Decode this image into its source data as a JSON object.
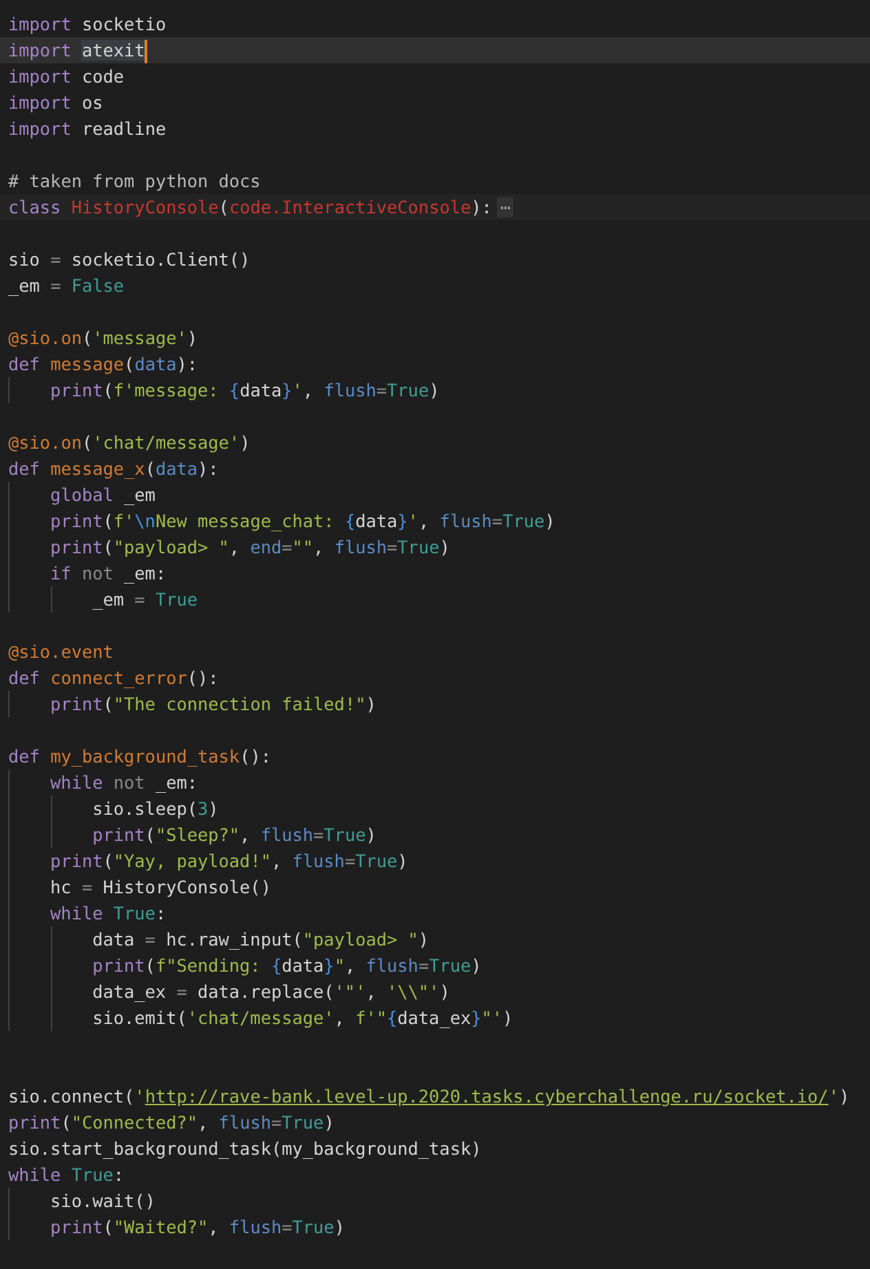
{
  "editor": {
    "lines": [
      {
        "kind": "code",
        "current": false,
        "tokens": [
          {
            "kind": "kw",
            "text": "import"
          },
          {
            "kind": "plain",
            "text": " socketio"
          }
        ]
      },
      {
        "kind": "code",
        "current": true,
        "tokens": [
          {
            "kind": "kw",
            "text": "import "
          },
          {
            "kind": "sel",
            "text": "atexit"
          }
        ]
      },
      {
        "kind": "code",
        "current": false,
        "tokens": [
          {
            "kind": "kw",
            "text": "import"
          },
          {
            "kind": "plain",
            "text": " code"
          }
        ]
      },
      {
        "kind": "code",
        "current": false,
        "tokens": [
          {
            "kind": "kw",
            "text": "import"
          },
          {
            "kind": "plain",
            "text": " os"
          }
        ]
      },
      {
        "kind": "code",
        "current": false,
        "tokens": [
          {
            "kind": "kw",
            "text": "import"
          },
          {
            "kind": "plain",
            "text": " readline"
          }
        ]
      },
      {
        "kind": "blank"
      },
      {
        "kind": "code",
        "current": false,
        "tokens": [
          {
            "kind": "comment",
            "text": "# taken from python docs"
          }
        ]
      },
      {
        "kind": "code",
        "current": false,
        "tokens": [
          {
            "kind": "kw",
            "text": "class "
          },
          {
            "kind": "cls",
            "text": "HistoryConsole"
          },
          {
            "kind": "plain",
            "text": "("
          },
          {
            "kind": "cls",
            "text": "code.InteractiveConsole"
          },
          {
            "kind": "plain",
            "text": "):"
          },
          {
            "kind": "fold",
            "text": "⋯"
          }
        ]
      },
      {
        "kind": "blank"
      },
      {
        "kind": "code",
        "current": false,
        "tokens": [
          {
            "kind": "plain",
            "text": "sio "
          },
          {
            "kind": "op",
            "text": "="
          },
          {
            "kind": "plain",
            "text": " socketio.Client()"
          }
        ]
      },
      {
        "kind": "code",
        "current": false,
        "tokens": [
          {
            "kind": "plain",
            "text": "_em "
          },
          {
            "kind": "op",
            "text": "="
          },
          {
            "kind": "const",
            "text": " False"
          }
        ]
      },
      {
        "kind": "blank"
      },
      {
        "kind": "code",
        "current": false,
        "tokens": [
          {
            "kind": "func",
            "text": "@sio.on"
          },
          {
            "kind": "plain",
            "text": "("
          },
          {
            "kind": "str",
            "text": "'message'"
          },
          {
            "kind": "plain",
            "text": ")"
          }
        ]
      },
      {
        "kind": "code",
        "current": false,
        "tokens": [
          {
            "kind": "kw",
            "text": "def "
          },
          {
            "kind": "func",
            "text": "message"
          },
          {
            "kind": "plain",
            "text": "("
          },
          {
            "kind": "param",
            "text": "data"
          },
          {
            "kind": "plain",
            "text": "):"
          }
        ],
        "children": [
          {
            "kind": "code",
            "current": false,
            "tokens": [
              {
                "kind": "kw",
                "text": "print"
              },
              {
                "kind": "plain",
                "text": "("
              },
              {
                "kind": "str",
                "text": "f'message: "
              },
              {
                "kind": "interp",
                "text": "{"
              },
              {
                "kind": "plain",
                "text": "data"
              },
              {
                "kind": "interp",
                "text": "}"
              },
              {
                "kind": "str",
                "text": "'"
              },
              {
                "kind": "plain",
                "text": ", "
              },
              {
                "kind": "param",
                "text": "flush"
              },
              {
                "kind": "op",
                "text": "="
              },
              {
                "kind": "const",
                "text": "True"
              },
              {
                "kind": "plain",
                "text": ")"
              }
            ]
          }
        ]
      },
      {
        "kind": "blank"
      },
      {
        "kind": "code",
        "current": false,
        "tokens": [
          {
            "kind": "func",
            "text": "@sio.on"
          },
          {
            "kind": "plain",
            "text": "("
          },
          {
            "kind": "str",
            "text": "'chat/message'"
          },
          {
            "kind": "plain",
            "text": ")"
          }
        ]
      },
      {
        "kind": "code",
        "current": false,
        "tokens": [
          {
            "kind": "kw",
            "text": "def "
          },
          {
            "kind": "func",
            "text": "message_x"
          },
          {
            "kind": "plain",
            "text": "("
          },
          {
            "kind": "param",
            "text": "data"
          },
          {
            "kind": "plain",
            "text": "):"
          }
        ],
        "children": [
          {
            "kind": "code",
            "current": false,
            "tokens": [
              {
                "kind": "kw",
                "text": "global"
              },
              {
                "kind": "plain",
                "text": " _em"
              }
            ]
          },
          {
            "kind": "code",
            "current": false,
            "tokens": [
              {
                "kind": "kw",
                "text": "print"
              },
              {
                "kind": "plain",
                "text": "("
              },
              {
                "kind": "str",
                "text": "f'"
              },
              {
                "kind": "interp",
                "text": "\\n"
              },
              {
                "kind": "str",
                "text": "New message_chat: "
              },
              {
                "kind": "interp",
                "text": "{"
              },
              {
                "kind": "plain",
                "text": "data"
              },
              {
                "kind": "interp",
                "text": "}"
              },
              {
                "kind": "str",
                "text": "'"
              },
              {
                "kind": "plain",
                "text": ", "
              },
              {
                "kind": "param",
                "text": "flush"
              },
              {
                "kind": "op",
                "text": "="
              },
              {
                "kind": "const",
                "text": "True"
              },
              {
                "kind": "plain",
                "text": ")"
              }
            ]
          },
          {
            "kind": "code",
            "current": false,
            "tokens": [
              {
                "kind": "kw",
                "text": "print"
              },
              {
                "kind": "plain",
                "text": "("
              },
              {
                "kind": "str",
                "text": "\"payload> \""
              },
              {
                "kind": "plain",
                "text": ", "
              },
              {
                "kind": "param",
                "text": "end"
              },
              {
                "kind": "op",
                "text": "="
              },
              {
                "kind": "str",
                "text": "\"\""
              },
              {
                "kind": "plain",
                "text": ", "
              },
              {
                "kind": "param",
                "text": "flush"
              },
              {
                "kind": "op",
                "text": "="
              },
              {
                "kind": "const",
                "text": "True"
              },
              {
                "kind": "plain",
                "text": ")"
              }
            ]
          },
          {
            "kind": "code",
            "current": false,
            "tokens": [
              {
                "kind": "kw",
                "text": "if "
              },
              {
                "kind": "op",
                "text": "not"
              },
              {
                "kind": "plain",
                "text": " _em:"
              }
            ],
            "children": [
              {
                "kind": "code",
                "current": false,
                "tokens": [
                  {
                    "kind": "plain",
                    "text": "_em "
                  },
                  {
                    "kind": "op",
                    "text": "="
                  },
                  {
                    "kind": "const",
                    "text": " True"
                  }
                ]
              }
            ]
          }
        ]
      },
      {
        "kind": "blank"
      },
      {
        "kind": "code",
        "current": false,
        "tokens": [
          {
            "kind": "func",
            "text": "@sio.event"
          }
        ]
      },
      {
        "kind": "code",
        "current": false,
        "tokens": [
          {
            "kind": "kw",
            "text": "def "
          },
          {
            "kind": "func",
            "text": "connect_error"
          },
          {
            "kind": "plain",
            "text": "():"
          }
        ],
        "children": [
          {
            "kind": "code",
            "current": false,
            "tokens": [
              {
                "kind": "kw",
                "text": "print"
              },
              {
                "kind": "plain",
                "text": "("
              },
              {
                "kind": "str",
                "text": "\"The connection failed!\""
              },
              {
                "kind": "plain",
                "text": ")"
              }
            ]
          }
        ]
      },
      {
        "kind": "blank"
      },
      {
        "kind": "code",
        "current": false,
        "tokens": [
          {
            "kind": "kw",
            "text": "def "
          },
          {
            "kind": "func",
            "text": "my_background_task"
          },
          {
            "kind": "plain",
            "text": "():"
          }
        ],
        "children": [
          {
            "kind": "code",
            "current": false,
            "tokens": [
              {
                "kind": "kw",
                "text": "while "
              },
              {
                "kind": "op",
                "text": "not"
              },
              {
                "kind": "plain",
                "text": " _em:"
              }
            ],
            "children": [
              {
                "kind": "code",
                "current": false,
                "tokens": [
                  {
                    "kind": "plain",
                    "text": "sio.sleep("
                  },
                  {
                    "kind": "const",
                    "text": "3"
                  },
                  {
                    "kind": "plain",
                    "text": ")"
                  }
                ]
              },
              {
                "kind": "code",
                "current": false,
                "tokens": [
                  {
                    "kind": "kw",
                    "text": "print"
                  },
                  {
                    "kind": "plain",
                    "text": "("
                  },
                  {
                    "kind": "str",
                    "text": "\"Sleep?\""
                  },
                  {
                    "kind": "plain",
                    "text": ", "
                  },
                  {
                    "kind": "param",
                    "text": "flush"
                  },
                  {
                    "kind": "op",
                    "text": "="
                  },
                  {
                    "kind": "const",
                    "text": "True"
                  },
                  {
                    "kind": "plain",
                    "text": ")"
                  }
                ]
              }
            ]
          },
          {
            "kind": "code",
            "current": false,
            "tokens": [
              {
                "kind": "kw",
                "text": "print"
              },
              {
                "kind": "plain",
                "text": "("
              },
              {
                "kind": "str",
                "text": "\"Yay, payload!\""
              },
              {
                "kind": "plain",
                "text": ", "
              },
              {
                "kind": "param",
                "text": "flush"
              },
              {
                "kind": "op",
                "text": "="
              },
              {
                "kind": "const",
                "text": "True"
              },
              {
                "kind": "plain",
                "text": ")"
              }
            ]
          },
          {
            "kind": "code",
            "current": false,
            "tokens": [
              {
                "kind": "plain",
                "text": "hc "
              },
              {
                "kind": "op",
                "text": "="
              },
              {
                "kind": "plain",
                "text": " HistoryConsole()"
              }
            ]
          },
          {
            "kind": "code",
            "current": false,
            "tokens": [
              {
                "kind": "kw",
                "text": "while "
              },
              {
                "kind": "const",
                "text": "True"
              },
              {
                "kind": "plain",
                "text": ":"
              }
            ],
            "children": [
              {
                "kind": "code",
                "current": false,
                "tokens": [
                  {
                    "kind": "plain",
                    "text": "data "
                  },
                  {
                    "kind": "op",
                    "text": "="
                  },
                  {
                    "kind": "plain",
                    "text": " hc.raw_input("
                  },
                  {
                    "kind": "str",
                    "text": "\"payload> \""
                  },
                  {
                    "kind": "plain",
                    "text": ")"
                  }
                ]
              },
              {
                "kind": "code",
                "current": false,
                "tokens": [
                  {
                    "kind": "kw",
                    "text": "print"
                  },
                  {
                    "kind": "plain",
                    "text": "("
                  },
                  {
                    "kind": "str",
                    "text": "f\"Sending: "
                  },
                  {
                    "kind": "interp",
                    "text": "{"
                  },
                  {
                    "kind": "plain",
                    "text": "data"
                  },
                  {
                    "kind": "interp",
                    "text": "}"
                  },
                  {
                    "kind": "str",
                    "text": "\""
                  },
                  {
                    "kind": "plain",
                    "text": ", "
                  },
                  {
                    "kind": "param",
                    "text": "flush"
                  },
                  {
                    "kind": "op",
                    "text": "="
                  },
                  {
                    "kind": "const",
                    "text": "True"
                  },
                  {
                    "kind": "plain",
                    "text": ")"
                  }
                ]
              },
              {
                "kind": "code",
                "current": false,
                "tokens": [
                  {
                    "kind": "plain",
                    "text": "data_ex "
                  },
                  {
                    "kind": "op",
                    "text": "="
                  },
                  {
                    "kind": "plain",
                    "text": " data.replace("
                  },
                  {
                    "kind": "str",
                    "text": "'\"'"
                  },
                  {
                    "kind": "plain",
                    "text": ", "
                  },
                  {
                    "kind": "str",
                    "text": "'\\\\\"'"
                  },
                  {
                    "kind": "plain",
                    "text": ")"
                  }
                ]
              },
              {
                "kind": "code",
                "current": false,
                "tokens": [
                  {
                    "kind": "plain",
                    "text": "sio.emit("
                  },
                  {
                    "kind": "str",
                    "text": "'chat/message'"
                  },
                  {
                    "kind": "plain",
                    "text": ", "
                  },
                  {
                    "kind": "str",
                    "text": "f'\""
                  },
                  {
                    "kind": "interp",
                    "text": "{"
                  },
                  {
                    "kind": "plain",
                    "text": "data_ex"
                  },
                  {
                    "kind": "interp",
                    "text": "}"
                  },
                  {
                    "kind": "str",
                    "text": "\"'"
                  },
                  {
                    "kind": "plain",
                    "text": ")"
                  }
                ]
              }
            ]
          }
        ]
      },
      {
        "kind": "blank"
      },
      {
        "kind": "blank"
      },
      {
        "kind": "code",
        "current": false,
        "tokens": [
          {
            "kind": "plain",
            "text": "sio.connect("
          },
          {
            "kind": "str",
            "text": "'"
          },
          {
            "kind": "link",
            "text": "http://rave-bank.level-up.2020.tasks.cyberchallenge.ru/socket.io/"
          },
          {
            "kind": "str",
            "text": "'"
          },
          {
            "kind": "plain",
            "text": ")"
          }
        ]
      },
      {
        "kind": "code",
        "current": false,
        "tokens": [
          {
            "kind": "kw",
            "text": "print"
          },
          {
            "kind": "plain",
            "text": "("
          },
          {
            "kind": "str",
            "text": "\"Connected?\""
          },
          {
            "kind": "plain",
            "text": ", "
          },
          {
            "kind": "param",
            "text": "flush"
          },
          {
            "kind": "op",
            "text": "="
          },
          {
            "kind": "const",
            "text": "True"
          },
          {
            "kind": "plain",
            "text": ")"
          }
        ]
      },
      {
        "kind": "code",
        "current": false,
        "tokens": [
          {
            "kind": "plain",
            "text": "sio.start_background_task(my_background_task)"
          }
        ]
      },
      {
        "kind": "code",
        "current": false,
        "tokens": [
          {
            "kind": "kw",
            "text": "while "
          },
          {
            "kind": "const",
            "text": "True"
          },
          {
            "kind": "plain",
            "text": ":"
          }
        ],
        "children": [
          {
            "kind": "code",
            "current": false,
            "tokens": [
              {
                "kind": "plain",
                "text": "sio.wait()"
              }
            ]
          },
          {
            "kind": "code",
            "current": false,
            "tokens": [
              {
                "kind": "kw",
                "text": "print"
              },
              {
                "kind": "plain",
                "text": "("
              },
              {
                "kind": "str",
                "text": "\"Waited?\""
              },
              {
                "kind": "plain",
                "text": ", "
              },
              {
                "kind": "param",
                "text": "flush"
              },
              {
                "kind": "op",
                "text": "="
              },
              {
                "kind": "const",
                "text": "True"
              },
              {
                "kind": "plain",
                "text": ")"
              }
            ]
          }
        ]
      }
    ]
  }
}
